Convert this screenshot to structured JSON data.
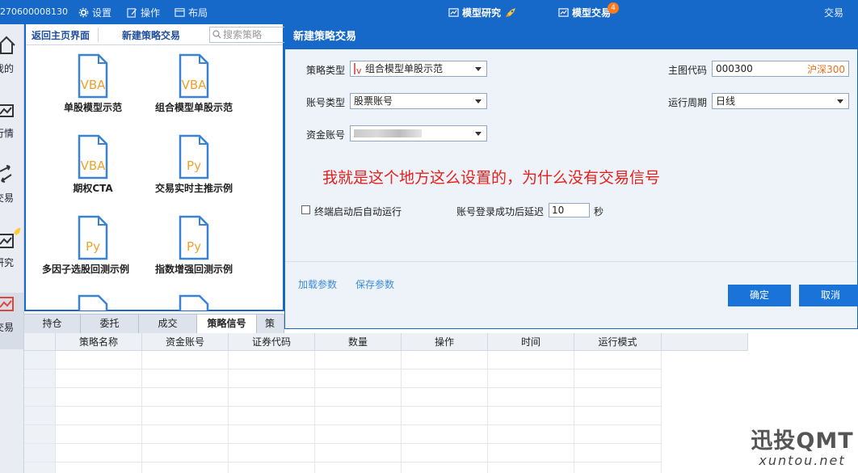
{
  "topbar": {
    "account": "270600008130",
    "menus": {
      "settings": "设置",
      "operate": "操作",
      "layout": "布局"
    },
    "model_research": "模型研究",
    "model_trade": "模型交易",
    "model_trade_badge": "4",
    "trade": "交易"
  },
  "sidebar": {
    "items": [
      {
        "label": "我的"
      },
      {
        "label": "行情"
      },
      {
        "label": "交易"
      },
      {
        "label": "模型研究"
      },
      {
        "label": "模型交易"
      }
    ]
  },
  "panel": {
    "tab_home": "返回主页界面",
    "tab_new": "新建策略交易",
    "search_placeholder": "搜索策略",
    "tiles": [
      {
        "type": "VBA",
        "name": "单股模型示范"
      },
      {
        "type": "VBA",
        "name": "组合模型单股示范"
      },
      {
        "type": "VBA",
        "name": "期权CTA"
      },
      {
        "type": "Py",
        "name": "交易实时主推示例"
      },
      {
        "type": "Py",
        "name": "多因子选股回测示例"
      },
      {
        "type": "Py",
        "name": "指数增强回测示例"
      }
    ]
  },
  "bottom_tabs": [
    "持仓",
    "委托",
    "成交",
    "策略信号",
    "策略"
  ],
  "grid": {
    "headers": [
      "策略名称",
      "资金账号",
      "证券代码",
      "数量",
      "操作",
      "时间",
      "运行模式"
    ]
  },
  "dialog": {
    "title": "新建策略交易",
    "strategy_type_label": "策略类型",
    "strategy_type_value": "组合模型单股示范",
    "account_type_label": "账号类型",
    "account_type_value": "股票账号",
    "fund_account_label": "资金账号",
    "main_code_label": "主图代码",
    "main_code_value": "000300",
    "main_code_name": "沪深300",
    "period_label": "运行周期",
    "period_value": "日线",
    "note": "我就是这个地方这么设置的，为什么没有交易信号",
    "auto_run_label": "终端启动后自动运行",
    "delay_label": "账号登录成功后延迟",
    "delay_value": "10",
    "delay_unit": "秒",
    "load_params": "加载参数",
    "save_params": "保存参数",
    "ok": "确定",
    "cancel": "取消"
  },
  "watermark": {
    "brand": "迅投QMT",
    "url": "xuntou.net"
  }
}
